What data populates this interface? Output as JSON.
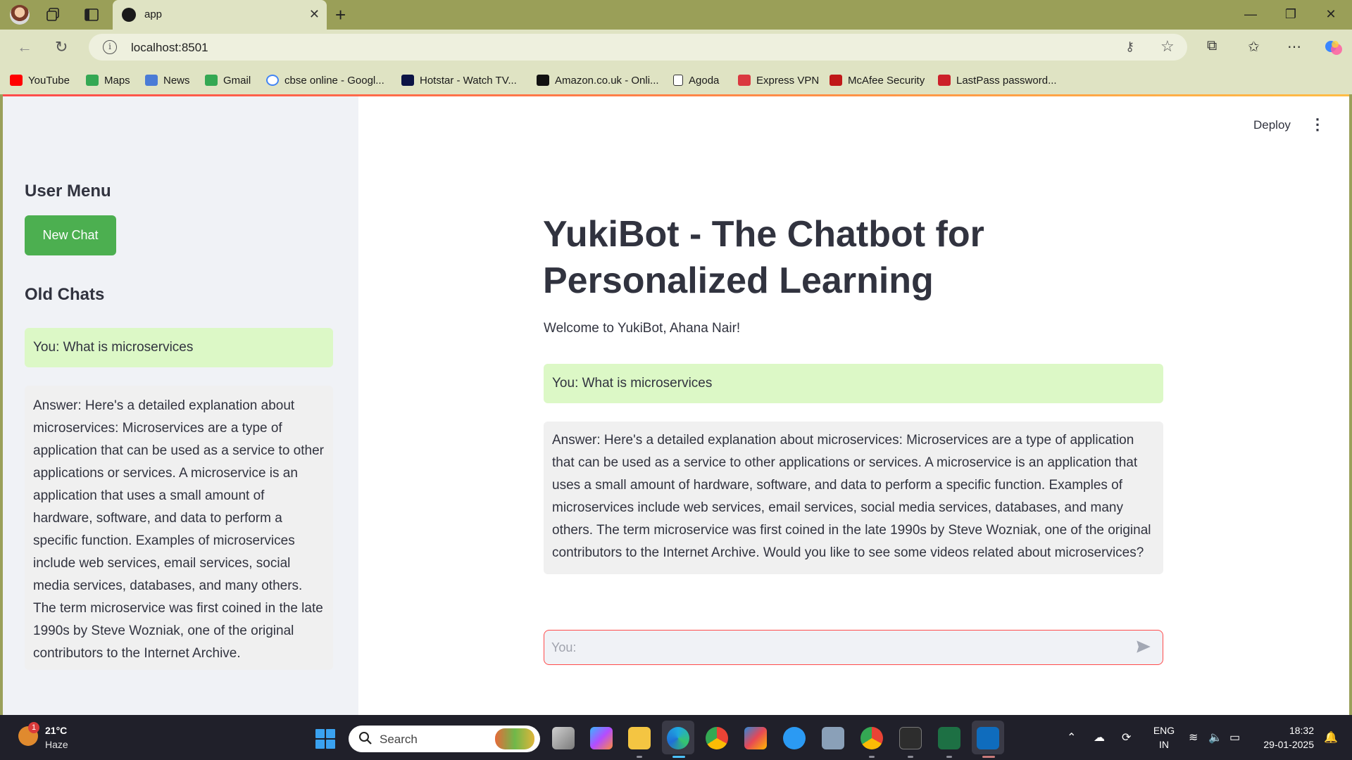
{
  "browser": {
    "tab_title": "app",
    "url": "localhost:8501",
    "bookmarks": [
      {
        "label": "YouTube",
        "icon": "youtube-icon",
        "color": "#ff0000"
      },
      {
        "label": "Maps",
        "icon": "maps-icon",
        "color": "#34a853"
      },
      {
        "label": "News",
        "icon": "news-icon",
        "color": "#4a7bd6"
      },
      {
        "label": "Gmail",
        "icon": "gmail-icon",
        "color": "#34a853"
      },
      {
        "label": "cbse online - Googl...",
        "icon": "google-icon",
        "color": "#4285f4"
      },
      {
        "label": "Hotstar - Watch TV...",
        "icon": "hotstar-icon",
        "color": "#0c1445"
      },
      {
        "label": "Amazon.co.uk - Onli...",
        "icon": "amazon-icon",
        "color": "#111111"
      },
      {
        "label": "Agoda",
        "icon": "page-icon",
        "color": "#ffffff"
      },
      {
        "label": "Express VPN",
        "icon": "expressvpn-icon",
        "color": "#da3940"
      },
      {
        "label": "McAfee Security",
        "icon": "mcafee-icon",
        "color": "#c01818"
      },
      {
        "label": "LastPass password...",
        "icon": "lastpass-icon",
        "color": "#cc2029"
      }
    ]
  },
  "app": {
    "deploy_label": "Deploy",
    "sidebar": {
      "user_menu_heading": "User Menu",
      "new_chat_label": "New Chat",
      "old_chats_heading": "Old Chats",
      "old_chat_user": "You: What is microservices",
      "old_chat_answer": "Answer: Here's a detailed explanation about microservices: Microservices are a type of application that can be used as a service to other applications or services. A microservice is an application that uses a small amount of hardware, software, and data to perform a specific function. Examples of microservices include web services, email services, social media services, databases, and many others. The term microservice was first coined in the late 1990s by Steve Wozniak, one of the original contributors to the Internet Archive."
    },
    "main": {
      "title": "YukiBot - The Chatbot for Personalized Learning",
      "welcome": "Welcome to YukiBot, Ahana Nair!",
      "user_message": "You: What is microservices",
      "answer": "Answer: Here's a detailed explanation about microservices: Microservices are a type of application that can be used as a service to other applications or services. A microservice is an application that uses a small amount of hardware, software, and data to perform a specific function. Examples of microservices include web services, email services, social media services, databases, and many others. The term microservice was first coined in the late 1990s by Steve Wozniak, one of the original contributors to the Internet Archive. Would you like to see some videos related about microservices?",
      "input_placeholder": "You:"
    },
    "colors": {
      "accent_green": "#4caf50",
      "user_bubble": "#dcf8c6",
      "answer_bubble": "#f0f0f0",
      "input_border": "#ff4b4b"
    }
  },
  "taskbar": {
    "weather_temp": "21°C",
    "weather_condition": "Haze",
    "weather_badge": "1",
    "search_label": "Search",
    "language_top": "ENG",
    "language_bottom": "IN",
    "time": "18:32",
    "date": "29-01-2025"
  }
}
